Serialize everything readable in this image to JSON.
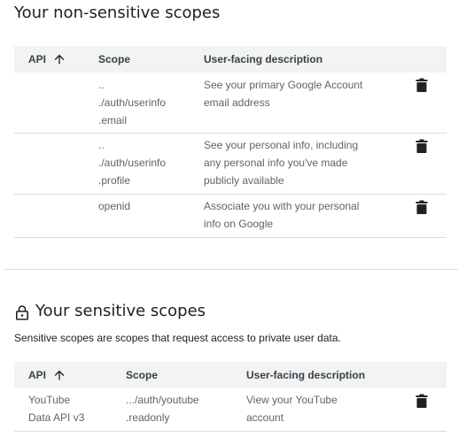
{
  "non_sensitive": {
    "title": "Your non-sensitive scopes",
    "columns": {
      "api": "API",
      "scope": "Scope",
      "description": "User-facing description"
    },
    "rows": [
      {
        "api": "",
        "scope_lines": [
          "..",
          "./auth/userinfo",
          ".email"
        ],
        "description_lines": [
          "See your primary Google Account",
          "email address"
        ],
        "delete_icon": "trash-icon"
      },
      {
        "api": "",
        "scope_lines": [
          "..",
          "./auth/userinfo",
          ".profile"
        ],
        "description_lines": [
          "See your personal info, including",
          "any personal info you've made",
          "publicly available"
        ],
        "delete_icon": "trash-icon"
      },
      {
        "api": "",
        "scope_lines": [
          "openid"
        ],
        "description_lines": [
          "Associate you with your personal",
          "info on Google"
        ],
        "delete_icon": "trash-icon"
      }
    ]
  },
  "sensitive": {
    "icon": "lock-icon",
    "title": "Your sensitive scopes",
    "subtitle": "Sensitive scopes are scopes that request access to private user data.",
    "columns": {
      "api": "API",
      "scope": "Scope",
      "description": "User-facing description"
    },
    "rows": [
      {
        "api_lines": [
          "YouTube",
          "Data API v3"
        ],
        "scope_lines": [
          ".../auth/youtube",
          ".readonly"
        ],
        "description_lines": [
          "View your YouTube",
          "account"
        ],
        "delete_icon": "trash-icon"
      }
    ]
  },
  "icons": {
    "sort": "arrow-upward-icon",
    "delete": "trash-icon",
    "lock": "lock-icon"
  },
  "colors": {
    "header_bg": "#f1f3f4",
    "divider": "#dadce0",
    "text_primary": "#202124",
    "text_secondary": "#5f6368"
  }
}
